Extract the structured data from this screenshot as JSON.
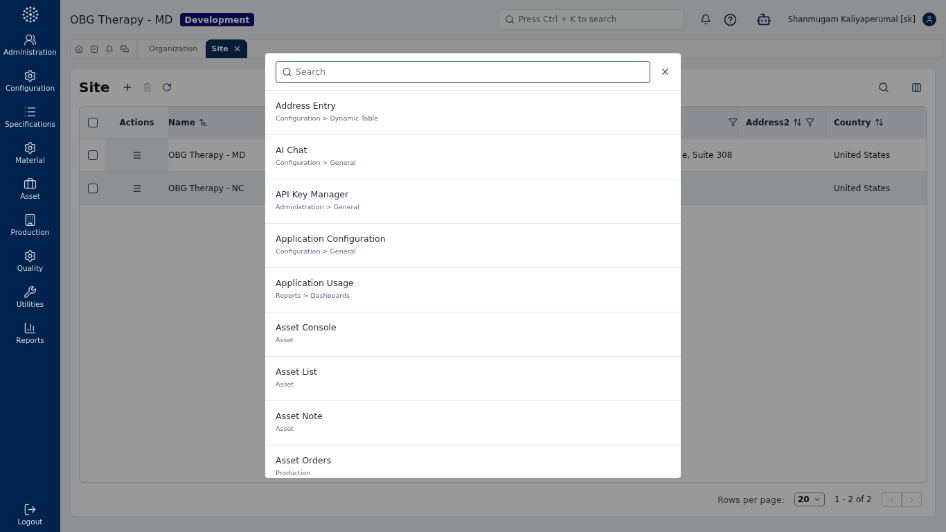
{
  "sidebar": {
    "items": [
      {
        "label": "Administration"
      },
      {
        "label": "Configuration"
      },
      {
        "label": "Specifications"
      },
      {
        "label": "Material"
      },
      {
        "label": "Asset"
      },
      {
        "label": "Production"
      },
      {
        "label": "Quality"
      },
      {
        "label": "Utilities"
      },
      {
        "label": "Reports"
      }
    ],
    "logout": {
      "label": "Logout"
    }
  },
  "topbar": {
    "title": "OBG Therapy - MD",
    "environment": "Development",
    "search": {
      "placeholder": "Press Ctrl + K to search"
    },
    "user": "Shanmugam Kaliyaperumal [sk]"
  },
  "tabs": [
    {
      "label": "Organization",
      "selected": false,
      "closable": false
    },
    {
      "label": "Site",
      "selected": true,
      "closable": true
    }
  ],
  "page": {
    "title": "Site",
    "delete_disabled": true
  },
  "table": {
    "header_checkbox": {
      "checked": false
    },
    "columns": [
      {
        "label": "Actions"
      },
      {
        "label": "Name",
        "sortable": true,
        "sorted_ascending": true
      },
      {
        "filter": true
      },
      {
        "label": "Address2",
        "sortable": true,
        "sorted_ascending": false,
        "filter": true
      },
      {
        "label": "Country",
        "sortable": true,
        "sorted_ascending": false
      }
    ],
    "rows": [
      {
        "checked": false,
        "name": "OBG Therapy - MD",
        "column_3": "e, Suite 308",
        "country": "United States"
      },
      {
        "checked": false,
        "name": "OBG Therapy - NC",
        "country": "United States"
      }
    ]
  },
  "pagination": {
    "label": "Rows per page:",
    "rows_per_page": "20",
    "range": "1 - 2 of 2"
  },
  "search_dialog": {
    "search": {
      "placeholder": "Search"
    },
    "results": [
      {
        "title": "Address Entry",
        "path": "Configuration > Dynamic Table"
      },
      {
        "title": "AI Chat",
        "path": "Configuration > General"
      },
      {
        "title": "API Key Manager",
        "path": "Administration > General"
      },
      {
        "title": "Application Configuration",
        "path": "Configuration > General"
      },
      {
        "title": "Application Usage",
        "path": "Reports > Dashboards"
      },
      {
        "title": "Asset Console",
        "path": "Asset"
      },
      {
        "title": "Asset List",
        "path": "Asset"
      },
      {
        "title": "Asset Note",
        "path": "Asset"
      },
      {
        "title": "Asset Orders",
        "path": "Production"
      }
    ]
  }
}
